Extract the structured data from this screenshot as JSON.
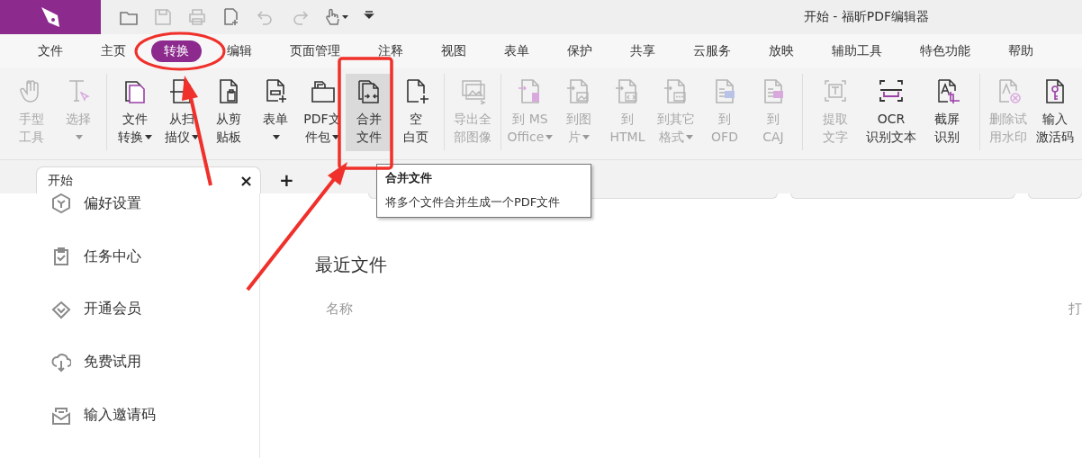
{
  "window": {
    "title": "开始 - 福昕PDF编辑器"
  },
  "menu": [
    {
      "label": "文件",
      "selected": false
    },
    {
      "label": "主页",
      "selected": false
    },
    {
      "label": "转换",
      "selected": true
    },
    {
      "label": "编辑",
      "selected": false
    },
    {
      "label": "页面管理",
      "selected": false
    },
    {
      "label": "注释",
      "selected": false
    },
    {
      "label": "视图",
      "selected": false
    },
    {
      "label": "表单",
      "selected": false
    },
    {
      "label": "保护",
      "selected": false
    },
    {
      "label": "共享",
      "selected": false
    },
    {
      "label": "云服务",
      "selected": false
    },
    {
      "label": "放映",
      "selected": false
    },
    {
      "label": "辅助工具",
      "selected": false
    },
    {
      "label": "特色功能",
      "selected": false
    },
    {
      "label": "帮助",
      "selected": false
    }
  ],
  "ribbon": {
    "groups": [
      [
        {
          "lines": [
            "手型",
            "工具"
          ],
          "disabled": true,
          "dropdown": false,
          "hovered": false
        },
        {
          "lines": [
            "选择"
          ],
          "disabled": true,
          "dropdown": true,
          "hovered": false
        }
      ],
      [
        {
          "lines": [
            "文件",
            "转换"
          ],
          "disabled": false,
          "dropdown": true,
          "hovered": false
        },
        {
          "lines": [
            "从扫",
            "描仪"
          ],
          "disabled": false,
          "dropdown": true,
          "hovered": false
        },
        {
          "lines": [
            "从剪",
            "贴板"
          ],
          "disabled": false,
          "dropdown": false,
          "hovered": false
        },
        {
          "lines": [
            "表单"
          ],
          "disabled": false,
          "dropdown": true,
          "hovered": false
        },
        {
          "lines": [
            "PDF文",
            "件包"
          ],
          "disabled": false,
          "dropdown": true,
          "hovered": false
        },
        {
          "lines": [
            "合并",
            "文件"
          ],
          "disabled": false,
          "dropdown": false,
          "hovered": true
        },
        {
          "lines": [
            "空",
            "白页"
          ],
          "disabled": false,
          "dropdown": false,
          "hovered": false
        }
      ],
      [
        {
          "lines": [
            "导出全",
            "部图像"
          ],
          "disabled": true,
          "dropdown": false,
          "hovered": false
        }
      ],
      [
        {
          "lines": [
            "到 MS",
            "Office"
          ],
          "disabled": true,
          "dropdown": true,
          "hovered": false
        },
        {
          "lines": [
            "到图",
            "片"
          ],
          "disabled": true,
          "dropdown": true,
          "hovered": false
        },
        {
          "lines": [
            "到",
            "HTML"
          ],
          "disabled": true,
          "dropdown": false,
          "hovered": false
        },
        {
          "lines": [
            "到其它",
            "格式"
          ],
          "disabled": true,
          "dropdown": true,
          "hovered": false
        },
        {
          "lines": [
            "到",
            "OFD"
          ],
          "disabled": true,
          "dropdown": false,
          "hovered": false
        },
        {
          "lines": [
            "到",
            "CAJ"
          ],
          "disabled": true,
          "dropdown": false,
          "hovered": false
        }
      ],
      [
        {
          "lines": [
            "提取",
            "文字"
          ],
          "disabled": true,
          "dropdown": false,
          "hovered": false
        },
        {
          "lines": [
            "OCR",
            "识别文本"
          ],
          "disabled": false,
          "dropdown": false,
          "hovered": false
        },
        {
          "lines": [
            "截屏",
            "识别"
          ],
          "disabled": false,
          "dropdown": false,
          "hovered": false
        }
      ],
      [
        {
          "lines": [
            "删除试",
            "用水印"
          ],
          "disabled": true,
          "dropdown": false,
          "hovered": false
        },
        {
          "lines": [
            "输入",
            "激活码"
          ],
          "disabled": false,
          "dropdown": false,
          "hovered": false
        }
      ]
    ]
  },
  "tabs": [
    {
      "label": "开始",
      "selected": true,
      "close": "×"
    }
  ],
  "new_tab": "+",
  "sidebar": {
    "items": [
      {
        "label": "偏好设置"
      },
      {
        "label": "任务中心"
      },
      {
        "label": "开通会员"
      },
      {
        "label": "免费试用"
      },
      {
        "label": "输入邀请码"
      }
    ]
  },
  "recent": {
    "title": "最近文件",
    "columns": [
      "名称",
      "打"
    ]
  },
  "tooltip": {
    "title": "合并文件",
    "description": "将多个文件合并生成一个PDF文件"
  }
}
